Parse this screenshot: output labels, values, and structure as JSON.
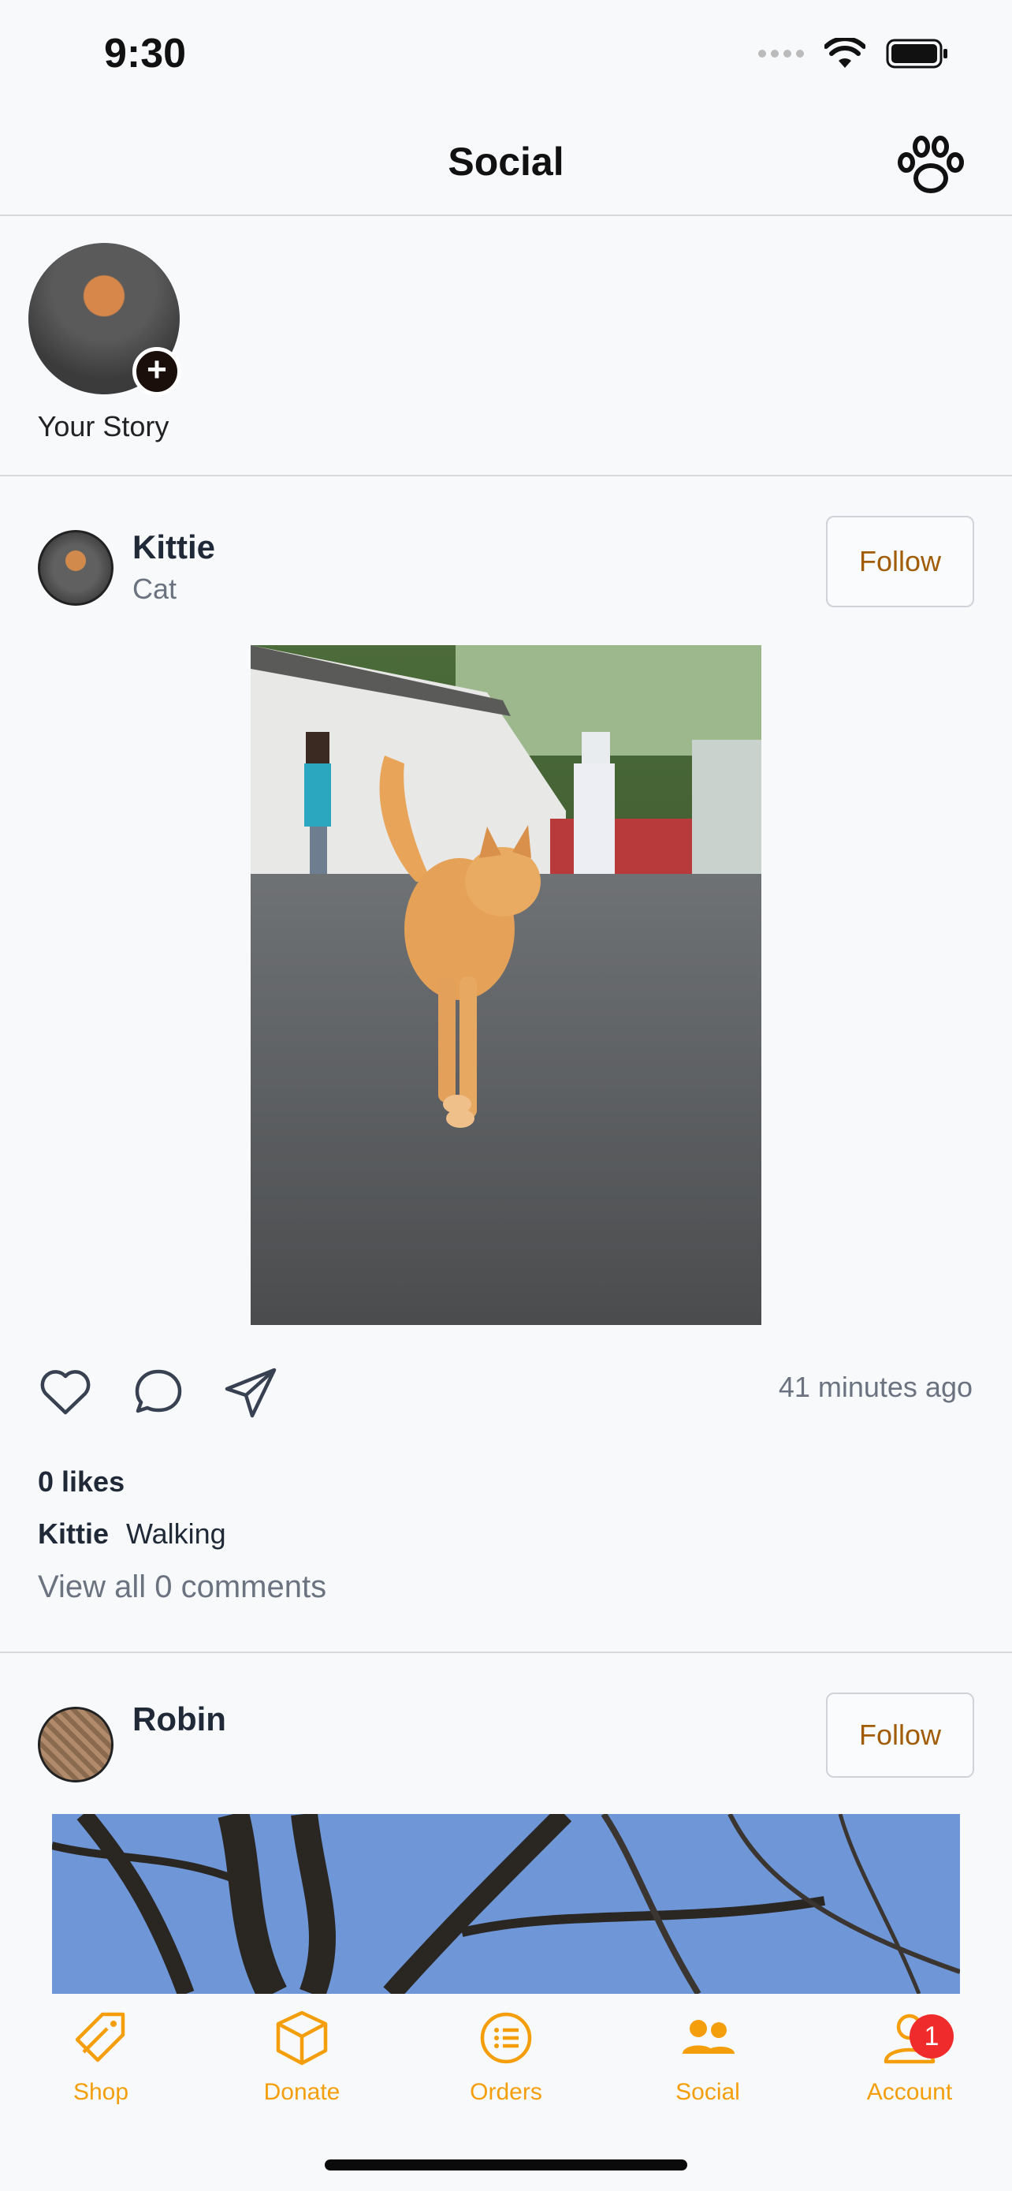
{
  "status_bar": {
    "time": "9:30"
  },
  "nav": {
    "title": "Social",
    "paw_icon": "paw-icon"
  },
  "stories": [
    {
      "label": "Your Story",
      "add_symbol": "+"
    }
  ],
  "posts": [
    {
      "author": "Kittie",
      "subtitle": "Cat",
      "follow_label": "Follow",
      "timestamp": "41 minutes ago",
      "likes": "0 likes",
      "caption_author": "Kittie",
      "caption_text": "Walking",
      "comments_link": "View all 0 comments"
    },
    {
      "author": "Robin",
      "follow_label": "Follow"
    }
  ],
  "tabs": [
    {
      "label": "Shop",
      "icon": "tag-icon"
    },
    {
      "label": "Donate",
      "icon": "box-icon"
    },
    {
      "label": "Orders",
      "icon": "list-icon"
    },
    {
      "label": "Social",
      "icon": "people-icon",
      "active": true
    },
    {
      "label": "Account",
      "icon": "user-icon",
      "badge": "1"
    }
  ],
  "colors": {
    "accent": "#f59e0b",
    "follow_text": "#a15c07",
    "badge": "#ef2b2b"
  }
}
